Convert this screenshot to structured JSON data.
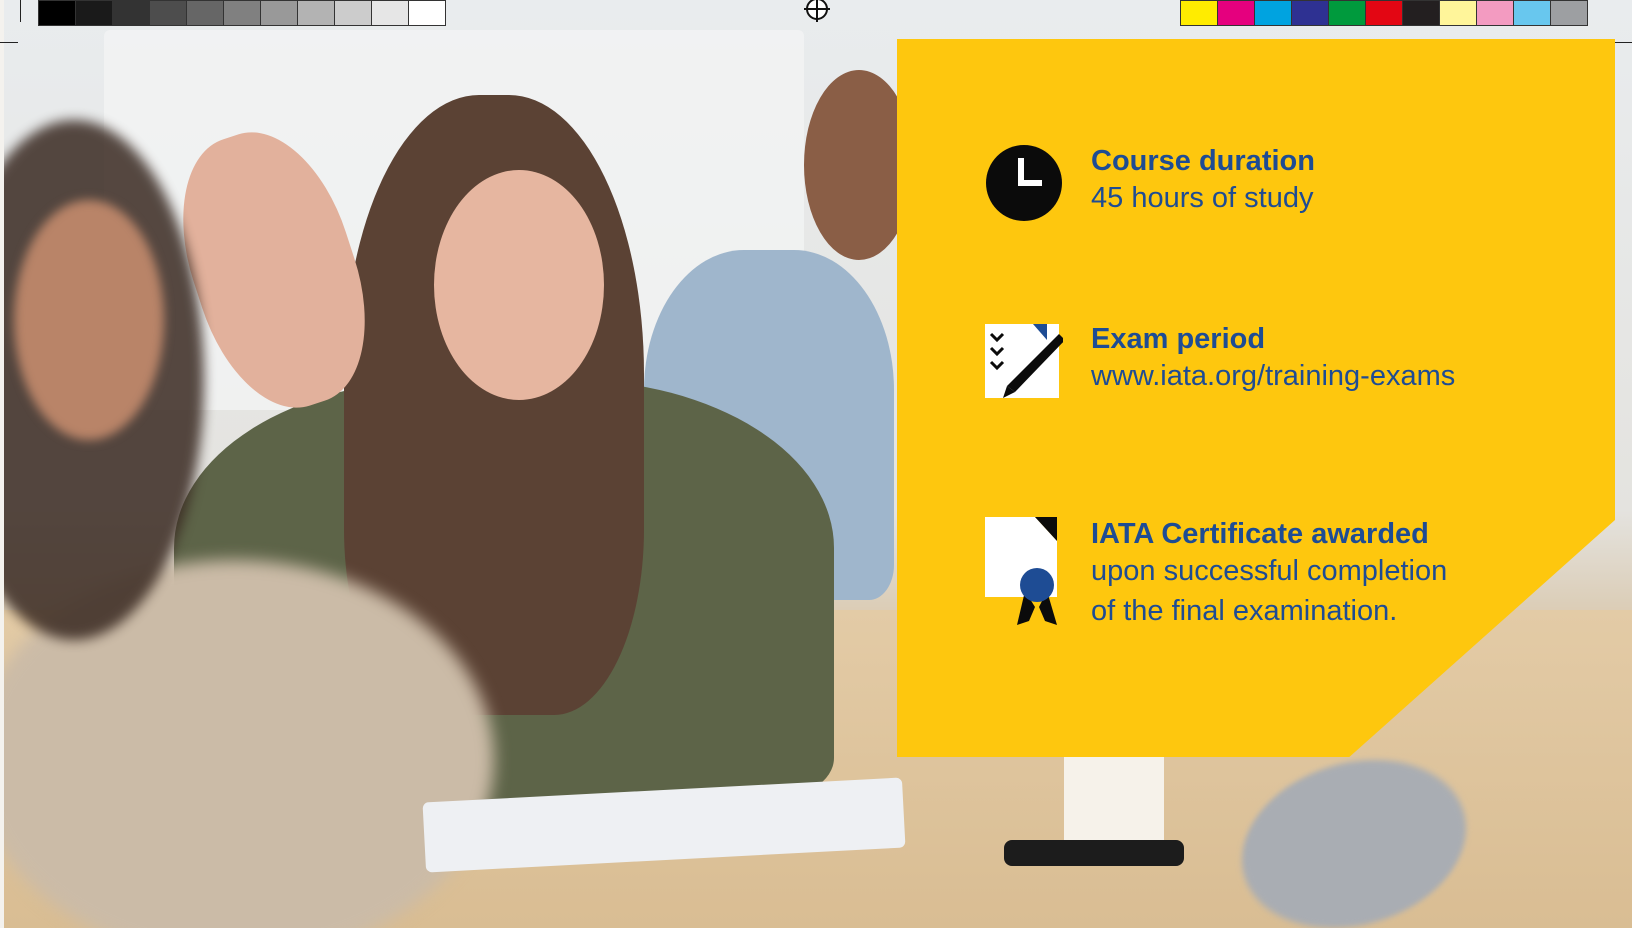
{
  "colors": {
    "panel": "#fec70e",
    "text": "#1e4c94",
    "icon_dark": "#0b0b0b",
    "icon_accent": "#1e4c94"
  },
  "print_marks": {
    "grayscale_swatches": [
      "#000000",
      "#1a1a1a",
      "#333333",
      "#4d4d4d",
      "#666666",
      "#808080",
      "#999999",
      "#b3b3b3",
      "#cccccc",
      "#e6e6e6",
      "#ffffff"
    ],
    "process_swatches": [
      "#ffec00",
      "#e5007e",
      "#00a3e0",
      "#2e3192",
      "#009a3d",
      "#e30613",
      "#231f20",
      "#fff59a",
      "#f39bc1",
      "#68c7ee",
      "#9d9fa2"
    ]
  },
  "info_items": [
    {
      "icon": "clock-icon",
      "title": "Course duration",
      "lines": [
        "45 hours of study"
      ]
    },
    {
      "icon": "exam-checklist-icon",
      "title": "Exam period",
      "lines": [
        "www.iata.org/training-exams"
      ]
    },
    {
      "icon": "certificate-ribbon-icon",
      "title": "IATA Certificate awarded",
      "lines": [
        "upon successful completion",
        "of the final examination."
      ]
    }
  ]
}
